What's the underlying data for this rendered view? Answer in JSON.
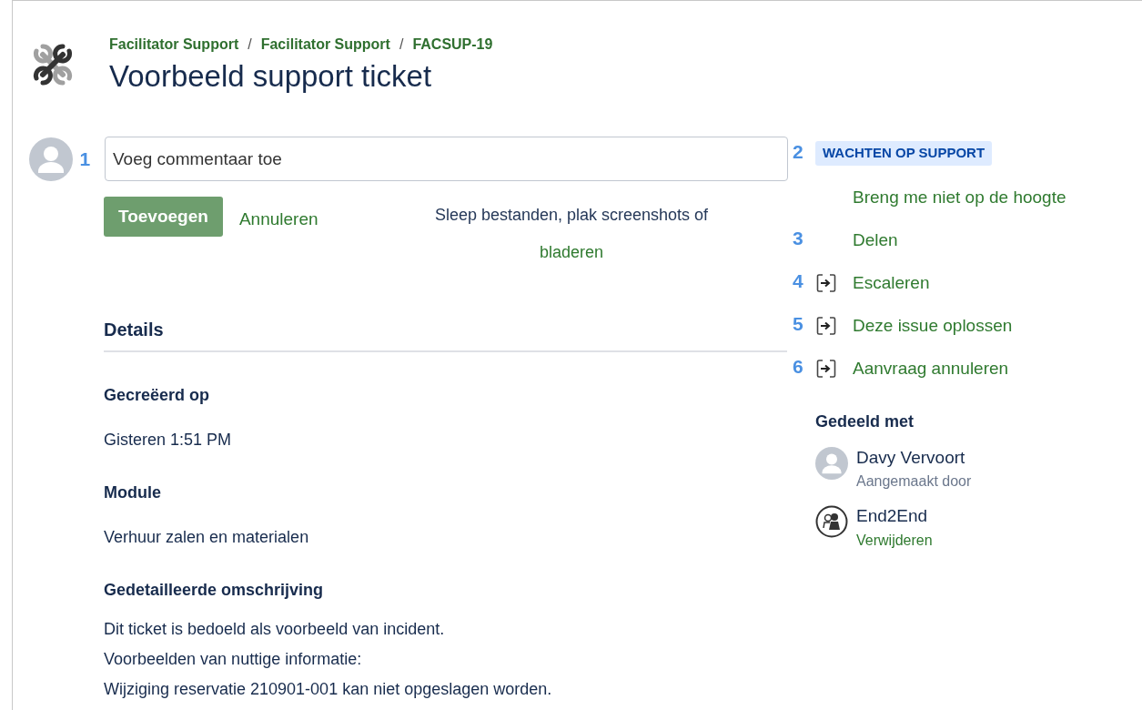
{
  "breadcrumbs": [
    {
      "label": "Facilitator Support"
    },
    {
      "separator": "/",
      "label": "Facilitator Support"
    },
    {
      "separator": "/",
      "label": "FACSUP-19"
    }
  ],
  "title": "Voorbeeld support ticket",
  "comment": {
    "marker": "1",
    "placeholder": "Voeg commentaar toe",
    "add_button": "Toevoegen",
    "cancel_link": "Annuleren"
  },
  "dropzone": {
    "text": "Sleep bestanden, plak screenshots of",
    "link": "bladeren"
  },
  "details": {
    "heading": "Details",
    "fields": [
      {
        "label": "Gecreëerd op",
        "value": "Gisteren 1:51 PM"
      },
      {
        "label": "Module",
        "value": "Verhuur zalen en materialen"
      }
    ],
    "description": {
      "label": "Gedetailleerde omschrijving",
      "lines": [
        "Dit ticket is bedoeld als voorbeeld van incident.",
        "Voorbeelden van nuttige informatie:",
        "Wijziging reservatie 210901-001 kan niet opgeslagen worden."
      ]
    }
  },
  "status": {
    "marker": "2",
    "label": "WACHTEN OP SUPPORT"
  },
  "actions": [
    {
      "kind": "plain",
      "label": "Breng me niet op de hoogte"
    },
    {
      "kind": "plain",
      "marker": "3",
      "label": "Delen"
    },
    {
      "kind": "transition",
      "marker": "4",
      "label": "Escaleren"
    },
    {
      "kind": "transition",
      "marker": "5",
      "label": "Deze issue oplossen"
    },
    {
      "kind": "transition",
      "marker": "6",
      "label": "Aanvraag annuleren"
    }
  ],
  "shared": {
    "heading": "Gedeeld met",
    "people": [
      {
        "kind": "user",
        "name": "Davy Vervoort",
        "sub": "Aangemaakt door",
        "sub_link": false
      },
      {
        "kind": "group",
        "name": "End2End",
        "sub": "Verwijderen",
        "sub_link": true
      }
    ]
  }
}
